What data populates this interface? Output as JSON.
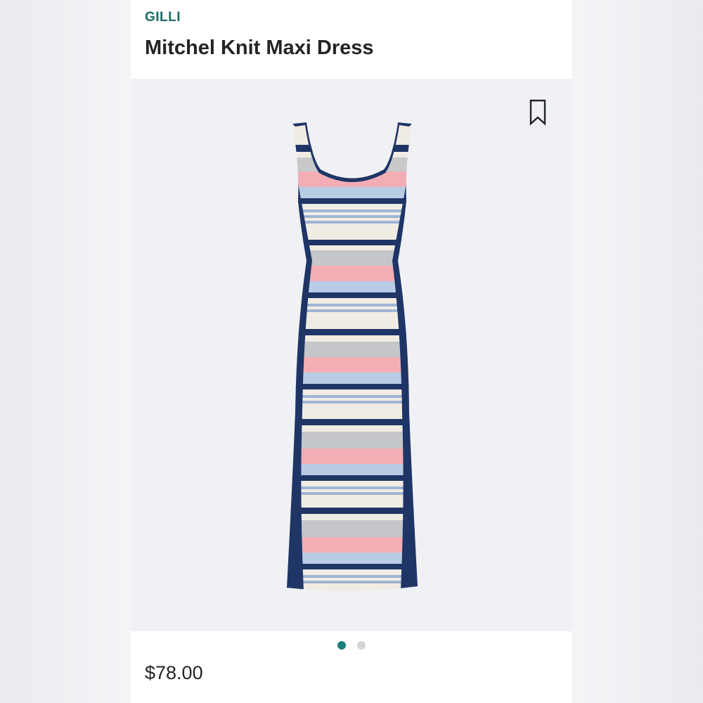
{
  "product": {
    "brand": "GILLI",
    "title": "Mitchel Knit Maxi Dress",
    "price": "$78.00"
  },
  "carousel": {
    "total_images": 2,
    "active_index": 0
  },
  "icons": {
    "save": "bookmark-icon"
  },
  "colors": {
    "brand_text": "#1b6b66",
    "active_dot": "#1b7e7a",
    "inactive_dot": "#d3d5d8",
    "image_background": "#f0f1f4",
    "stripe_navy": "#1f3566",
    "stripe_pink": "#f2aeb4",
    "stripe_light_blue": "#b9cce6",
    "stripe_gray": "#c4c6c9",
    "stripe_cream": "#f3efe6"
  }
}
